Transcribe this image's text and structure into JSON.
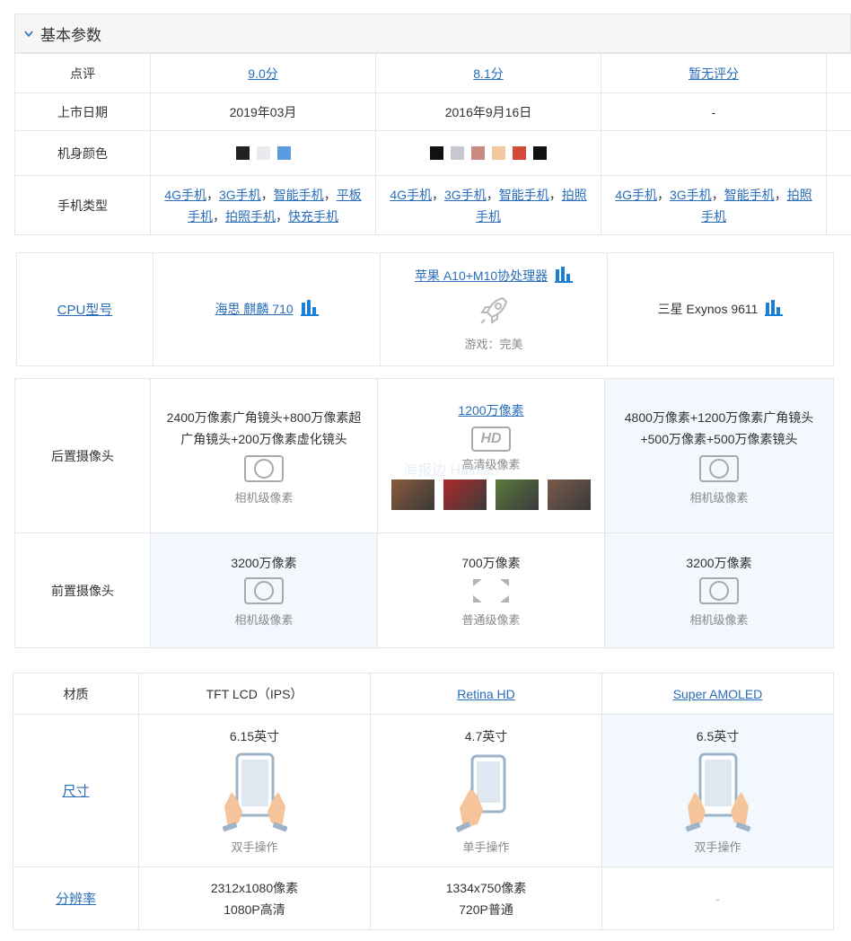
{
  "section1": {
    "title": "基本参数",
    "rows": {
      "rating": {
        "label": "点评",
        "values": [
          "9.0分",
          "8.1分",
          "暂无评分"
        ]
      },
      "date": {
        "label": "上市日期",
        "values": [
          "2019年03月",
          "2016年9月16日",
          "-"
        ]
      },
      "color": {
        "label": "机身颜色",
        "phone1": [
          "#222222",
          "#e9e9ee",
          "#5b9be0"
        ],
        "phone2": [
          "#111111",
          "#c8c8d0",
          "#c98a84",
          "#f2c89e",
          "#d44a3a",
          "#111111"
        ]
      },
      "type": {
        "label": "手机类型",
        "phone1": [
          "4G手机",
          "3G手机",
          "智能手机",
          "平板手机",
          "拍照手机",
          "快充手机"
        ],
        "phone2": [
          "4G手机",
          "3G手机",
          "智能手机",
          "拍照手机"
        ],
        "phone3": [
          "4G手机",
          "3G手机",
          "智能手机",
          "拍照手机"
        ]
      }
    }
  },
  "section2": {
    "cpu": {
      "label": "CPU型号",
      "phone1": "海思 麒麟 710",
      "phone2": "苹果 A10+M10协处理器",
      "phone2_note": "游戏：完美",
      "phone3": "三星 Exynos 9611"
    },
    "rear": {
      "label": "后置摄像头",
      "phone1": "2400万像素广角镜头+800万像素超广角镜头+200万像素虚化镜头",
      "phone1_note": "相机级像素",
      "phone2": "1200万像素",
      "phone2_badge": "HD",
      "phone2_note": "高清级像素",
      "phone2_thumbs": [
        "#8a5a3a",
        "#b02a2a",
        "#5a7a3a",
        "#7a5a4a"
      ],
      "watermark": "海报边 Haibian",
      "phone3": "4800万像素+1200万像素广角镜头+500万像素+500万像素镜头",
      "phone3_note": "相机级像素"
    },
    "front": {
      "label": "前置摄像头",
      "phone1": "3200万像素",
      "phone1_note": "相机级像素",
      "phone2": "700万像素",
      "phone2_note": "普通级像素",
      "phone3": "3200万像素",
      "phone3_note": "相机级像素"
    }
  },
  "section3": {
    "material": {
      "label": "材质",
      "phone1": "TFT LCD（IPS）",
      "phone2": "Retina HD",
      "phone3": "Super AMOLED"
    },
    "size": {
      "label": "尺寸",
      "phone1": "6.15英寸",
      "phone1_note": "双手操作",
      "phone2": "4.7英寸",
      "phone2_note": "单手操作",
      "phone3": "6.5英寸",
      "phone3_note": "双手操作"
    },
    "res": {
      "label": "分辨率",
      "phone1_l1": "2312x1080像素",
      "phone1_l2": "1080P高清",
      "phone2_l1": "1334x750像素",
      "phone2_l2": "720P普通",
      "phone3": "-"
    }
  },
  "colors": {
    "link": "#2a6db8",
    "icon_blue": "#1a7fd6",
    "highlight_bg": "#f2f8fd",
    "border": "#e6e6e6"
  }
}
